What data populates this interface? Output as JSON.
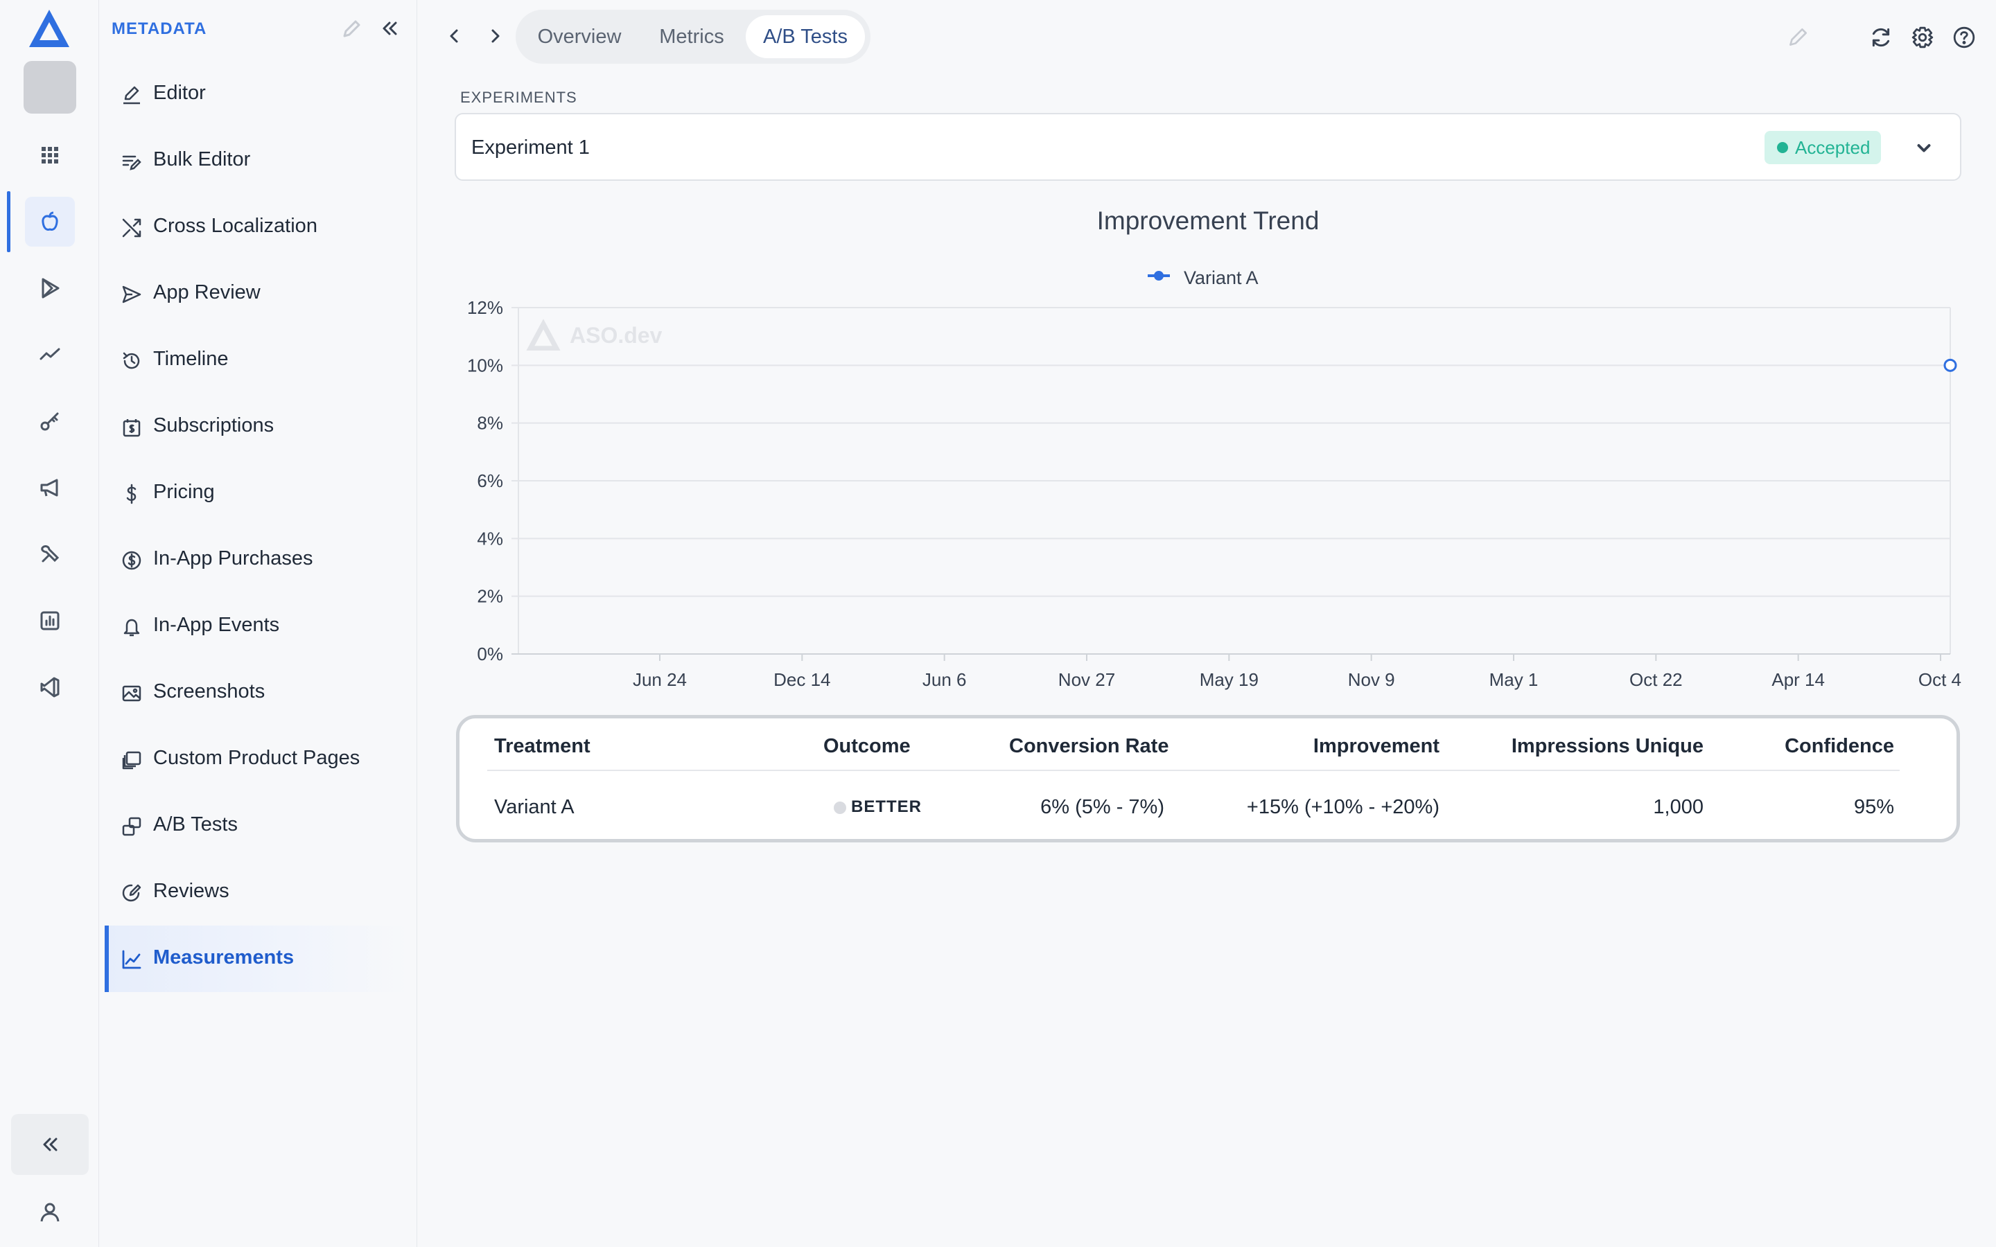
{
  "sidebar": {
    "heading": "METADATA",
    "items": [
      {
        "label": "Editor",
        "icon": "edit-icon"
      },
      {
        "label": "Bulk Editor",
        "icon": "bulk-edit-icon"
      },
      {
        "label": "Cross Localization",
        "icon": "shuffle-icon"
      },
      {
        "label": "App Review",
        "icon": "send-icon"
      },
      {
        "label": "Timeline",
        "icon": "history-icon"
      },
      {
        "label": "Subscriptions",
        "icon": "subscription-icon"
      },
      {
        "label": "Pricing",
        "icon": "dollar-icon"
      },
      {
        "label": "In-App Purchases",
        "icon": "coin-icon"
      },
      {
        "label": "In-App Events",
        "icon": "bell-icon"
      },
      {
        "label": "Screenshots",
        "icon": "image-icon"
      },
      {
        "label": "Custom Product Pages",
        "icon": "pages-icon"
      },
      {
        "label": "A/B Tests",
        "icon": "ab-test-icon"
      },
      {
        "label": "Reviews",
        "icon": "review-icon"
      },
      {
        "label": "Measurements",
        "icon": "line-chart-icon",
        "active": true
      }
    ]
  },
  "topbar": {
    "tabs": [
      "Overview",
      "Metrics",
      "A/B Tests"
    ],
    "active_tab": "A/B Tests"
  },
  "experiments": {
    "label": "EXPERIMENTS",
    "selected": "Experiment 1",
    "status": "Accepted",
    "status_color": "#22b394"
  },
  "chart_data": {
    "type": "line",
    "title": "Improvement Trend",
    "series": [
      {
        "name": "Variant A",
        "color": "#2f6fe0",
        "x": [
          "Oct 4"
        ],
        "values": [
          10
        ]
      }
    ],
    "x_ticks": [
      "Jun 24",
      "Dec 14",
      "Jun 6",
      "Nov 27",
      "May 19",
      "Nov 9",
      "May 1",
      "Oct 22",
      "Apr 14",
      "Oct 4"
    ],
    "y_ticks": [
      "0%",
      "2%",
      "4%",
      "6%",
      "8%",
      "10%",
      "12%"
    ],
    "ylim": [
      0,
      12
    ],
    "grid": true,
    "legend_position": "top-center",
    "watermark": "ASO.dev"
  },
  "table": {
    "headers": [
      "Treatment",
      "Outcome",
      "Conversion Rate",
      "Improvement",
      "Impressions Unique",
      "Confidence"
    ],
    "rows": [
      {
        "treatment": "Variant A",
        "outcome": "BETTER",
        "conversion_rate": "6% (5% - 7%)",
        "improvement": "+15% (+10% - +20%)",
        "impressions_unique": "1,000",
        "confidence": "95%"
      }
    ]
  },
  "colors": {
    "accent": "#2f6fe0",
    "border": "#cfd3d8"
  }
}
